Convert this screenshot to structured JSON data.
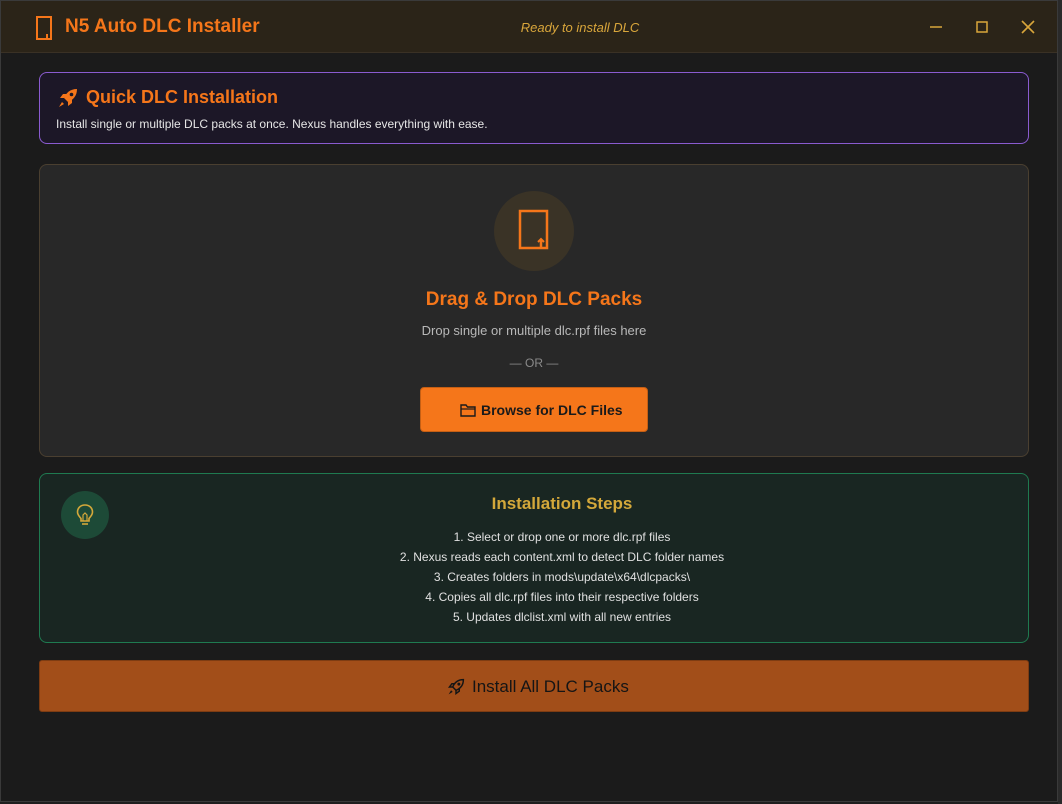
{
  "window": {
    "title": "N5 Auto DLC Installer",
    "status": "Ready to install DLC",
    "controls": [
      "minimize-icon",
      "maximize-icon",
      "close-icon"
    ]
  },
  "quick": {
    "title": "Quick DLC Installation",
    "subtitle": "Install single or multiple DLC packs at once. Nexus handles everything with ease.",
    "icon": "rocket-icon"
  },
  "dropzone": {
    "icon": "file-icon",
    "title": "Drag & Drop DLC Packs",
    "subtitle": "Drop single or multiple dlc.rpf files here",
    "divider": "— OR —",
    "browse_label": "Browse for DLC Files",
    "browse_icon": "folder-icon"
  },
  "steps": {
    "icon": "lightbulb-icon",
    "title": "Installation Steps",
    "items": [
      "1. Select or drop one or more dlc.rpf files",
      "2. Nexus reads each content.xml to detect DLC folder names",
      "3. Creates folders in mods\\update\\x64\\dlcpacks\\",
      "4. Copies all dlc.rpf files into their respective folders",
      "5. Updates dlclist.xml with all new entries"
    ]
  },
  "install": {
    "label": "Install All DLC Packs",
    "icon": "rocket-icon"
  },
  "colors": {
    "accent": "#f5761a",
    "gold": "#d4a83a",
    "purple_border": "#8a5bd0",
    "green_border": "#1f7a50",
    "install_bg": "#a24e19"
  }
}
